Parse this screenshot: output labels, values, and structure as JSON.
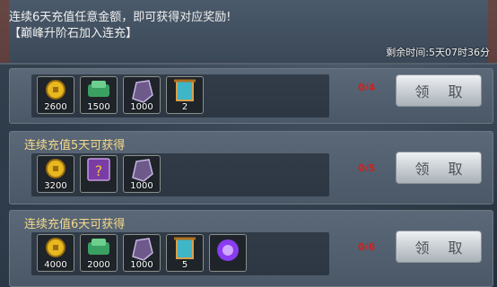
{
  "banner": {
    "line1": "连续6天充值任意金额，即可获得对应奖励!",
    "line2": "【巅峰升阶石加入连充】",
    "remaining": "剩余时间:5天07时36分"
  },
  "tiers": [
    {
      "title": "",
      "progress": "0/4",
      "claim_label": "领 取",
      "items": [
        {
          "icon": "gold-coin-icon",
          "qty": "2600"
        },
        {
          "icon": "jade-stack-icon",
          "qty": "1500"
        },
        {
          "icon": "purple-stone-icon",
          "qty": "1000"
        },
        {
          "icon": "scroll-icon",
          "qty": "2"
        }
      ]
    },
    {
      "title": "连续充值5天可获得",
      "progress": "0/5",
      "claim_label": "领 取",
      "items": [
        {
          "icon": "gold-coin-icon",
          "qty": "3200"
        },
        {
          "icon": "mystery-book-icon",
          "qty": ""
        },
        {
          "icon": "purple-stone-icon",
          "qty": "1000"
        }
      ]
    },
    {
      "title": "连续充值6天可获得",
      "progress": "0/6",
      "claim_label": "领 取",
      "items": [
        {
          "icon": "gold-coin-icon",
          "qty": "4000"
        },
        {
          "icon": "jade-stack-icon",
          "qty": "2000"
        },
        {
          "icon": "purple-stone-icon",
          "qty": "1000"
        },
        {
          "icon": "scroll-icon",
          "qty": "5"
        },
        {
          "icon": "purple-orb-icon",
          "qty": ""
        }
      ]
    }
  ]
}
